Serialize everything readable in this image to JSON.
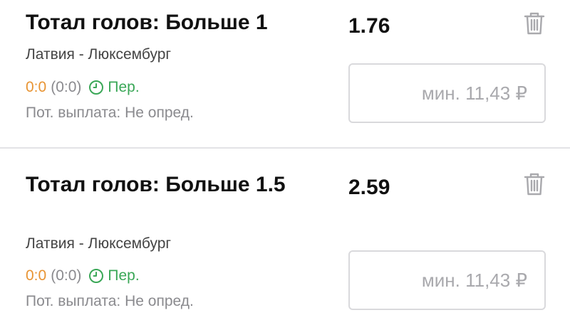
{
  "bets": [
    {
      "market": "Тотал голов: Больше 1",
      "odds": "1.76",
      "event": "Латвия - Люксембург",
      "score": "0:0",
      "score_half": "(0:0)",
      "period": "Пер.",
      "payout": "Пот. выплата: Не опред.",
      "stake_placeholder": "мин. 11,43 ₽",
      "delete_icon": "trash-icon"
    },
    {
      "market": "Тотал голов: Больше 1.5",
      "odds": "2.59",
      "event": "Латвия - Люксембург",
      "score": "0:0",
      "score_half": "(0:0)",
      "period": "Пер.",
      "payout": "Пот. выплата: Не опред.",
      "stake_placeholder": "мин. 11,43 ₽",
      "delete_icon": "trash-icon"
    }
  ],
  "colors": {
    "score": "#e89433",
    "period": "#3aa757",
    "muted": "#8a8a8e",
    "divider": "#e3e3e6"
  }
}
